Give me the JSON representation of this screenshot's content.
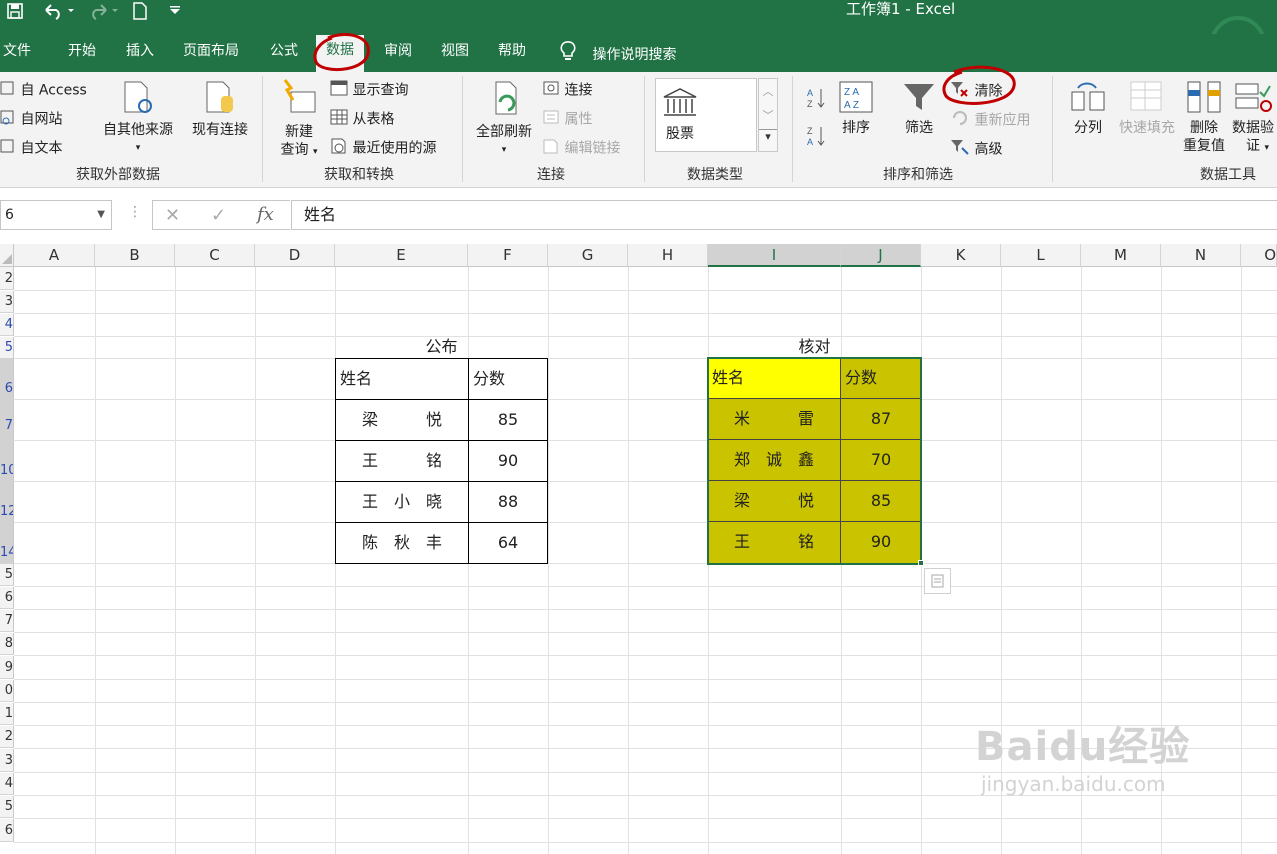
{
  "window": {
    "title": "工作簿1  -  Excel"
  },
  "quick_access": {
    "save_icon": "save-icon",
    "undo_icon": "undo-icon",
    "redo_icon": "redo-icon",
    "new_icon": "new-file-icon",
    "customize_icon": "customize-icon"
  },
  "tabs": [
    "文件",
    "开始",
    "插入",
    "页面布局",
    "公式",
    "数据",
    "审阅",
    "视图",
    "帮助"
  ],
  "active_tab": "数据",
  "tell_me": "操作说明搜索",
  "ribbon": {
    "get_external": {
      "access": "自 Access",
      "web": "自网站",
      "text": "自文本",
      "other_sources": "自其他来源",
      "existing": "现有连接",
      "label": "获取外部数据"
    },
    "get_transform": {
      "new_query_1": "新建",
      "new_query_2": "查询",
      "show_queries": "显示查询",
      "from_table": "从表格",
      "recent_sources": "最近使用的源",
      "label": "获取和转换"
    },
    "connections": {
      "refresh_all": "全部刷新",
      "connections": "连接",
      "properties": "属性",
      "edit_links": "编辑链接",
      "label": "连接"
    },
    "data_types": {
      "stocks": "股票",
      "label": "数据类型"
    },
    "sort_filter": {
      "sort": "排序",
      "filter": "筛选",
      "clear": "清除",
      "reapply": "重新应用",
      "advanced": "高级",
      "label": "排序和筛选"
    },
    "data_tools": {
      "text_to_columns": "分列",
      "flash_fill": "快速填充",
      "remove_dup_1": "删除",
      "remove_dup_2": "重复值",
      "validation_1": "数据验",
      "validation_2": "证",
      "label": "数据工具"
    }
  },
  "formula_bar": {
    "name_box": "6",
    "formula": "姓名"
  },
  "columns": [
    "A",
    "B",
    "C",
    "D",
    "E",
    "F",
    "G",
    "H",
    "I",
    "J",
    "K",
    "L",
    "M",
    "N",
    "O"
  ],
  "rows": [
    "2",
    "3",
    "4",
    "5",
    "6",
    "7",
    "10",
    "12",
    "14",
    "5",
    "6",
    "7",
    "8",
    "9",
    "0",
    "1",
    "2",
    "3",
    "4",
    "5",
    "6"
  ],
  "table_public": {
    "title": "公布",
    "headers": [
      "姓名",
      "分数"
    ],
    "rows": [
      {
        "name": "梁　　　悦",
        "score": "85"
      },
      {
        "name": "王　　　铭",
        "score": "90"
      },
      {
        "name": "王　小　晓",
        "score": "88"
      },
      {
        "name": "陈　秋　丰",
        "score": "64"
      }
    ]
  },
  "table_check": {
    "title": "核对",
    "headers": [
      "姓名",
      "分数"
    ],
    "rows": [
      {
        "name": "米　　　雷",
        "score": "87"
      },
      {
        "name": "郑　诚　鑫",
        "score": "70"
      },
      {
        "name": "梁　　　悦",
        "score": "85"
      },
      {
        "name": "王　　　铭",
        "score": "90"
      }
    ],
    "fill_color": "#c9c300",
    "header_fill": "#ffff00"
  },
  "watermark": {
    "brand": "Baidu经验",
    "url": "jingyan.baidu.com"
  },
  "colors": {
    "excel_green": "#217346",
    "annotation_red": "#c00000"
  }
}
